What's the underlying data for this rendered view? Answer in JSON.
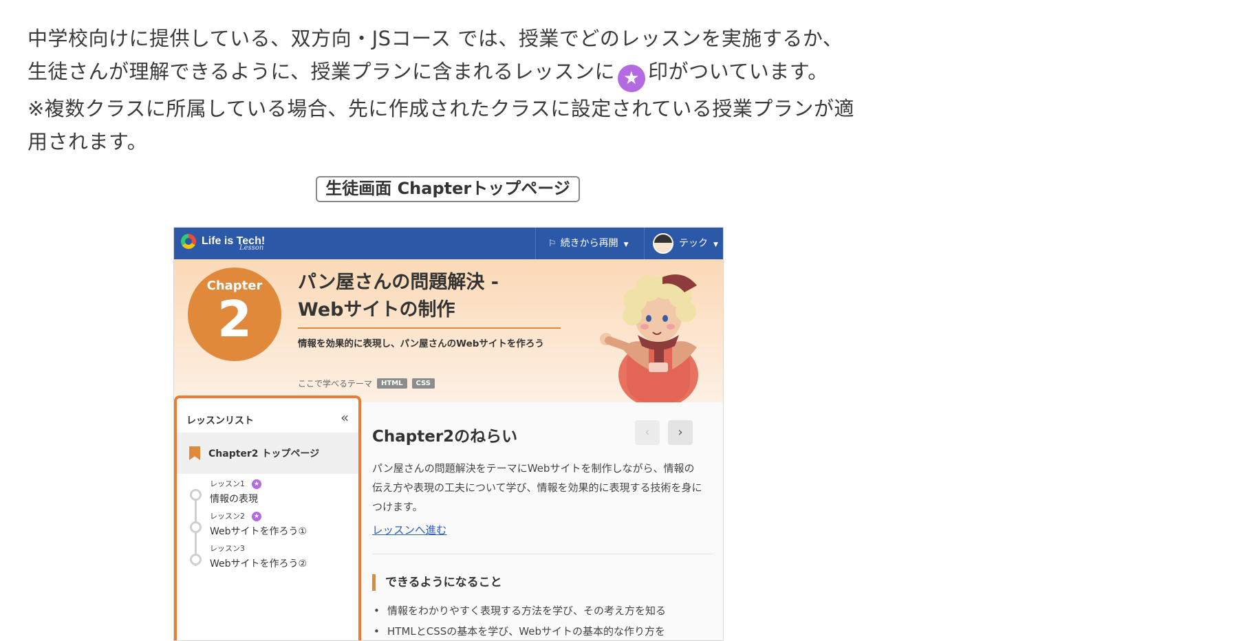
{
  "intro": {
    "line1": "中学校向けに提供している、双方向・JSコース では、授業でどのレッスンを実施するか、",
    "line2_a": "生徒さんが理解できるように、授業プランに含まれるレッスンに",
    "line2_b": "印がついています。",
    "line3": "※複数クラスに所属している場合、先に作成されたクラスに設定されている授業プランが適",
    "line4": "用されます。",
    "star_glyph": "★"
  },
  "caption": "生徒画面 Chapterトップページ",
  "header": {
    "logo_text": "Life is Tech!",
    "logo_sub": "Lesson",
    "resume_label": "続きから再開",
    "user_name": "テック"
  },
  "hero": {
    "chapter_label": "Chapter",
    "chapter_number": "2",
    "title_line1": "パン屋さんの問題解決 -",
    "title_line2": "Webサイトの制作",
    "description": "情報を効果的に表現し、パン屋さんのWebサイトを作ろう",
    "theme_label": "ここで学べるテーマ",
    "tags": [
      "HTML",
      "CSS"
    ]
  },
  "sidebar": {
    "heading": "レッスンリスト",
    "top_item": "Chapter2 トップページ",
    "lessons": [
      {
        "num": "レッスン1",
        "title": "情報の表現",
        "starred": true
      },
      {
        "num": "レッスン2",
        "title": "Webサイトを作ろう①",
        "starred": true
      },
      {
        "num": "レッスン3",
        "title": "Webサイトを作ろう②",
        "starred": false
      }
    ]
  },
  "content": {
    "title": "Chapter2のねらい",
    "body": "パン屋さんの問題解決をテーマにWebサイトを制作しながら、情報の伝え方や表現の工夫について学び、情報を効果的に表現する技術を身につけます。",
    "link": "レッスンへ進む",
    "subheading": "できるようになること",
    "bullets": [
      "情報をわかりやすく表現する方法を学び、その考え方を知る",
      "HTMLとCSSの基本を学び、Webサイトの基本的な作り方を"
    ]
  },
  "colors": {
    "header_bg": "#2c58a8",
    "accent_orange": "#e0893a",
    "sidebar_border": "#ee7a33",
    "star_purple": "#b46ae0",
    "link_blue": "#2a5cc9"
  }
}
